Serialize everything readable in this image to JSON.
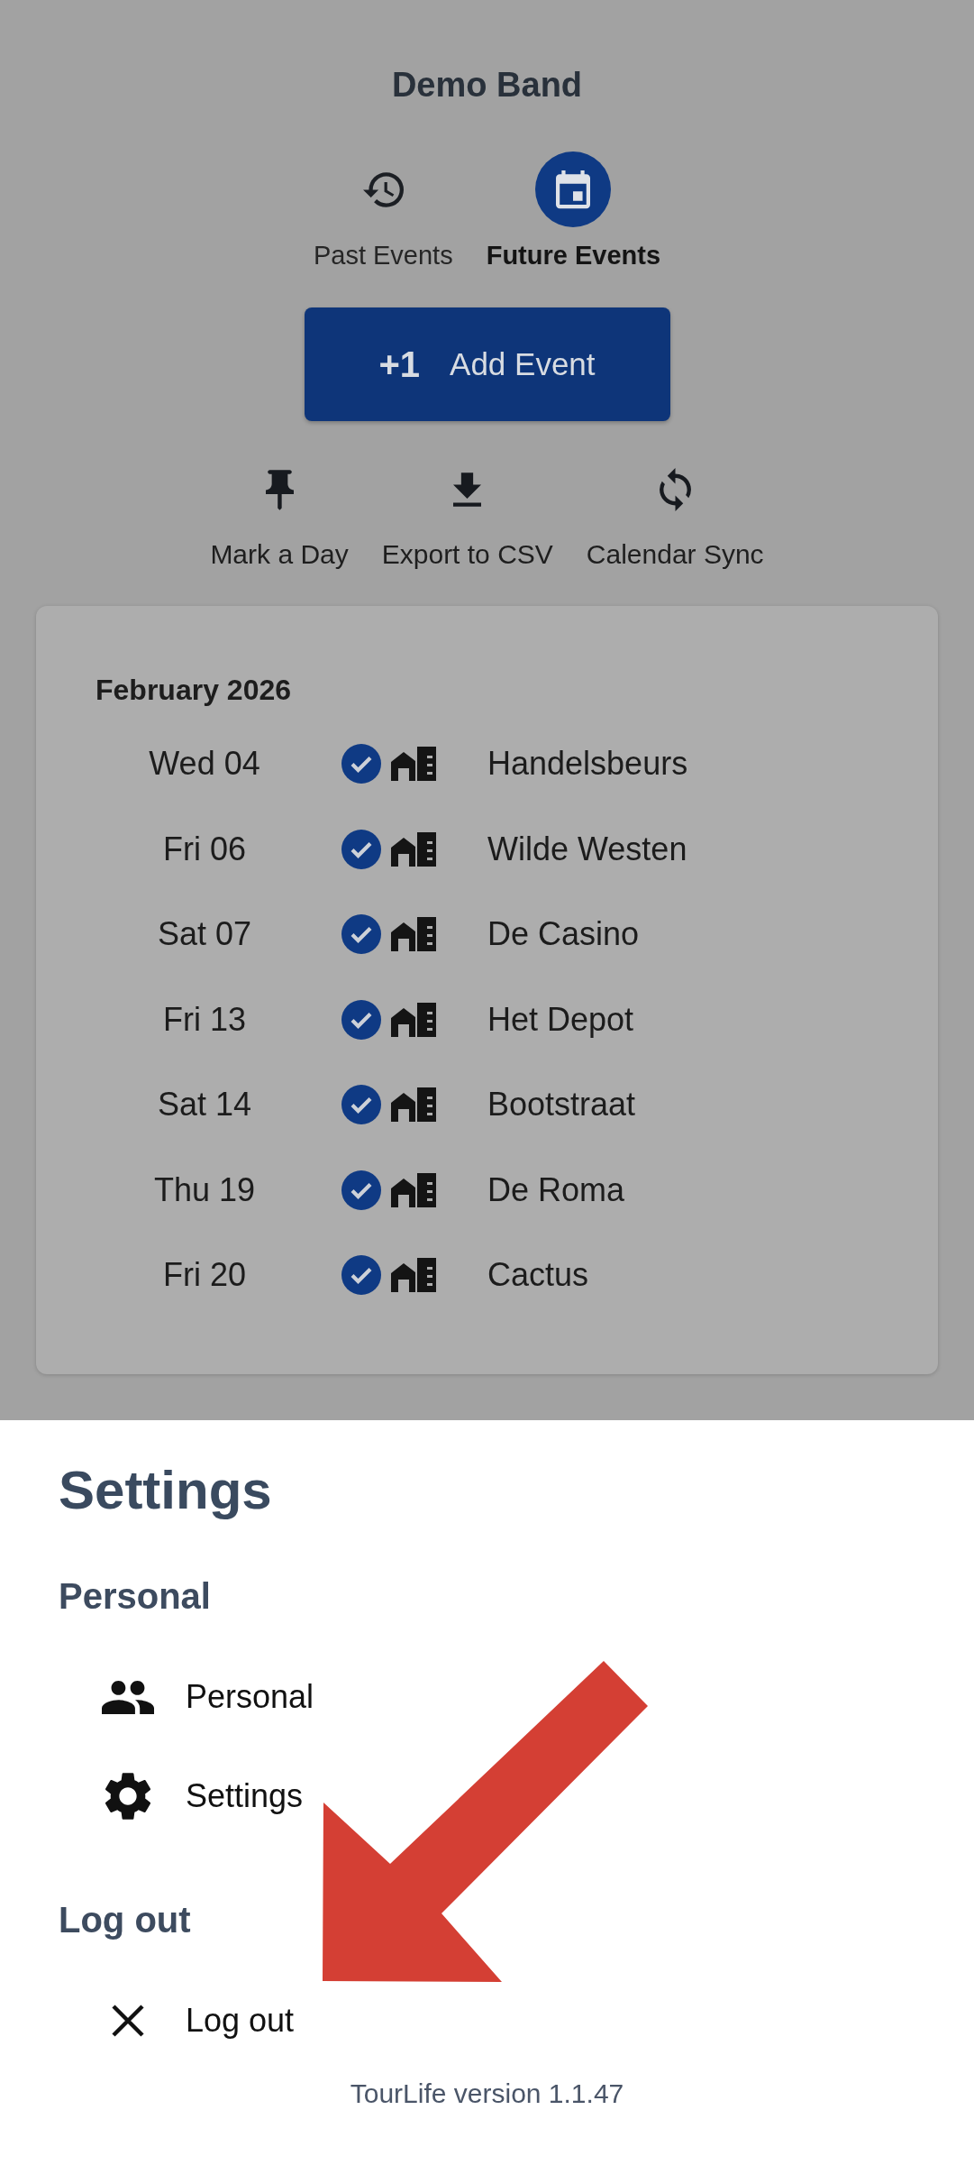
{
  "header": {
    "title": "Demo Band"
  },
  "tabs": [
    {
      "label": "Past Events",
      "selected": false
    },
    {
      "label": "Future Events",
      "selected": true
    }
  ],
  "add_button": {
    "prefix": "+1",
    "label": "Add Event"
  },
  "actions": [
    {
      "label": "Mark a Day"
    },
    {
      "label": "Export to CSV"
    },
    {
      "label": "Calendar Sync"
    }
  ],
  "events": {
    "month": "February 2026",
    "rows": [
      {
        "date": "Wed 04",
        "confirmed": true,
        "venue": "Handelsbeurs"
      },
      {
        "date": "Fri 06",
        "confirmed": true,
        "venue": "Wilde Westen"
      },
      {
        "date": "Sat 07",
        "confirmed": true,
        "venue": "De Casino"
      },
      {
        "date": "Fri 13",
        "confirmed": true,
        "venue": "Het Depot"
      },
      {
        "date": "Sat 14",
        "confirmed": true,
        "venue": "Bootstraat"
      },
      {
        "date": "Thu 19",
        "confirmed": true,
        "venue": "De Roma"
      },
      {
        "date": "Fri 20",
        "confirmed": true,
        "venue": "Cactus"
      }
    ]
  },
  "settings_sheet": {
    "title": "Settings",
    "sections": [
      {
        "heading": "Personal",
        "items": [
          {
            "label": "Personal"
          },
          {
            "label": "Settings"
          }
        ]
      },
      {
        "heading": "Log out",
        "items": [
          {
            "label": "Log out"
          }
        ]
      }
    ],
    "footer": "TourLife version 1.1.47"
  },
  "annotations": [
    {
      "kind": "arrow"
    }
  ]
}
